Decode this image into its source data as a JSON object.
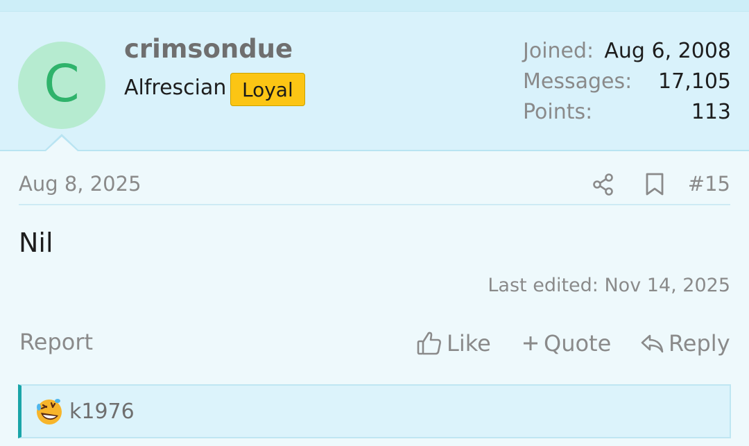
{
  "user": {
    "avatar_letter": "C",
    "username": "crimsondue",
    "title": "Alfrescian",
    "badge": "Loyal",
    "avatar_bg": "#b6ebd0",
    "avatar_fg": "#2fb36b",
    "badge_color": "#fcc514"
  },
  "stats": [
    {
      "label": "Joined:",
      "value": "Aug 6, 2008"
    },
    {
      "label": "Messages:",
      "value": "17,105"
    },
    {
      "label": "Points:",
      "value": "113"
    }
  ],
  "post": {
    "date": "Aug 8, 2025",
    "number": "#15",
    "body": "Nil",
    "last_edited": "Last edited: Nov 14, 2025",
    "share_icon": "share-icon",
    "bookmark_icon": "bookmark-icon"
  },
  "actions": {
    "report": "Report",
    "like": "Like",
    "quote": "Quote",
    "reply": "Reply"
  },
  "reactions": {
    "emoji": "rolling-on-floor-laughing",
    "user": "k1976",
    "accent": "#1aa5a8"
  }
}
